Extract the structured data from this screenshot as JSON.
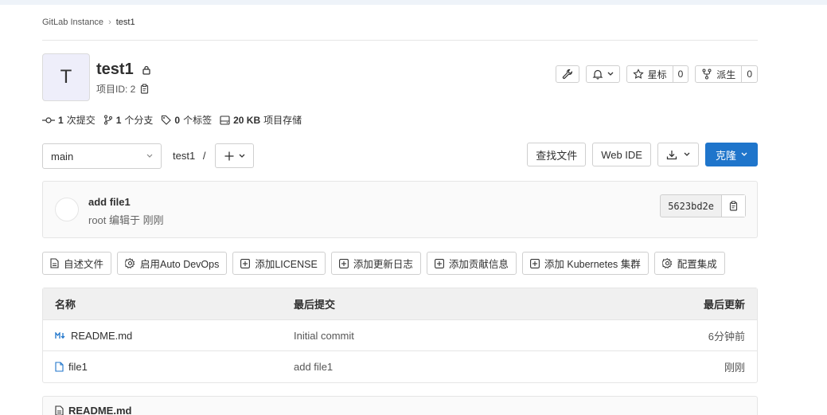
{
  "breadcrumb": {
    "root": "GitLab Instance",
    "sep": "›",
    "current": "test1"
  },
  "project": {
    "avatar_letter": "T",
    "name": "test1",
    "id_label": "项目ID: 2"
  },
  "header_buttons": {
    "star_label": "星标",
    "star_count": "0",
    "fork_label": "派生",
    "fork_count": "0"
  },
  "stats": {
    "commits_num": "1",
    "commits_label": "次提交",
    "branches_num": "1",
    "branches_label": "个分支",
    "tags_num": "0",
    "tags_label": "个标签",
    "storage_num": "20 KB",
    "storage_label": "项目存储"
  },
  "toolbar": {
    "branch": "main",
    "path": "test1",
    "path_sep": "/",
    "find_file": "查找文件",
    "web_ide": "Web IDE",
    "clone": "克隆"
  },
  "commit": {
    "message": "add file1",
    "meta": "root 编辑于 刚刚",
    "sha": "5623bd2e"
  },
  "quick_actions": [
    {
      "label": "自述文件",
      "icon": "file-icon"
    },
    {
      "label": "启用Auto DevOps",
      "icon": "gear-icon"
    },
    {
      "label": "添加LICENSE",
      "icon": "plus-square-icon"
    },
    {
      "label": "添加更新日志",
      "icon": "plus-square-icon"
    },
    {
      "label": "添加贡献信息",
      "icon": "plus-square-icon"
    },
    {
      "label": "添加 Kubernetes 集群",
      "icon": "plus-square-icon"
    },
    {
      "label": "配置集成",
      "icon": "gear-icon"
    }
  ],
  "table": {
    "headers": {
      "name": "名称",
      "last_commit": "最后提交",
      "last_update": "最后更新"
    },
    "rows": [
      {
        "name": "README.md",
        "commit": "Initial commit",
        "updated": "6分钟前",
        "icon": "markdown-icon"
      },
      {
        "name": "file1",
        "commit": "add file1",
        "updated": "刚刚",
        "icon": "file-icon"
      }
    ]
  },
  "readme": {
    "title": "README.md"
  },
  "colors": {
    "primary": "#1f75cb",
    "avatar_bg": "#eeeefa"
  }
}
